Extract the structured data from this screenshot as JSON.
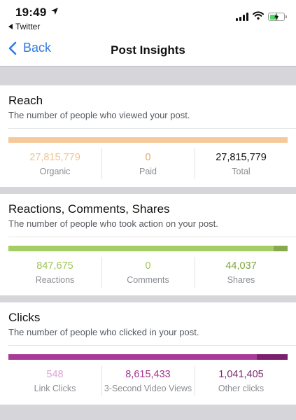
{
  "status_bar": {
    "time": "19:49",
    "back_to_app": "Twitter",
    "icons": [
      "location-arrow-icon",
      "cellular-signal-icon",
      "wifi-icon",
      "battery-charging-icon"
    ]
  },
  "nav": {
    "back_label": "Back",
    "title": "Post Insights"
  },
  "colors": {
    "accent_blue": "#2f7ae5",
    "reach_bar": "#f6c99a",
    "reach_text": "#f0c490",
    "engagement_bar": "#a4cd64",
    "engagement_bar_dark": "#86a94c",
    "engagement_text": "#8ab64a",
    "clicks_bar": "#a93b98",
    "clicks_bar_dark": "#7c1f6c",
    "clicks_light_text": "#d9a7d2",
    "clicks_text": "#7a2a70"
  },
  "sections": {
    "reach": {
      "title": "Reach",
      "description": "The number of people who viewed your post.",
      "bar_segments": [
        {
          "share": 1.0,
          "color": "#f6c99a"
        }
      ],
      "stats": [
        {
          "value": "27,815,779",
          "label": "Organic",
          "color": "#f0c490"
        },
        {
          "value": "0",
          "label": "Paid",
          "color": "#e4a868"
        },
        {
          "value": "27,815,779",
          "label": "Total",
          "color": "#111111"
        }
      ]
    },
    "engagement": {
      "title": "Reactions, Comments, Shares",
      "description": "The number of people who took action on your post.",
      "bar_segments": [
        {
          "share": 0.95,
          "color": "#a4cd64"
        },
        {
          "share": 0.05,
          "color": "#86a94c"
        }
      ],
      "stats": [
        {
          "value": "847,675",
          "label": "Reactions",
          "color": "#9cc45a"
        },
        {
          "value": "0",
          "label": "Comments",
          "color": "#9cc45a"
        },
        {
          "value": "44,037",
          "label": "Shares",
          "color": "#7ea640"
        }
      ]
    },
    "clicks": {
      "title": "Clicks",
      "description": "The number of people who clicked in your post.",
      "bar_segments": [
        {
          "share": 0.89,
          "color": "#a93b98"
        },
        {
          "share": 0.11,
          "color": "#7c1f6c"
        }
      ],
      "stats": [
        {
          "value": "548",
          "label": "Link Clicks",
          "color": "#d9a7d2"
        },
        {
          "value": "8,615,433",
          "label": "3-Second Video Views",
          "color": "#a0358f"
        },
        {
          "value": "1,041,405",
          "label": "Other clicks",
          "color": "#7a2a70"
        }
      ]
    }
  }
}
